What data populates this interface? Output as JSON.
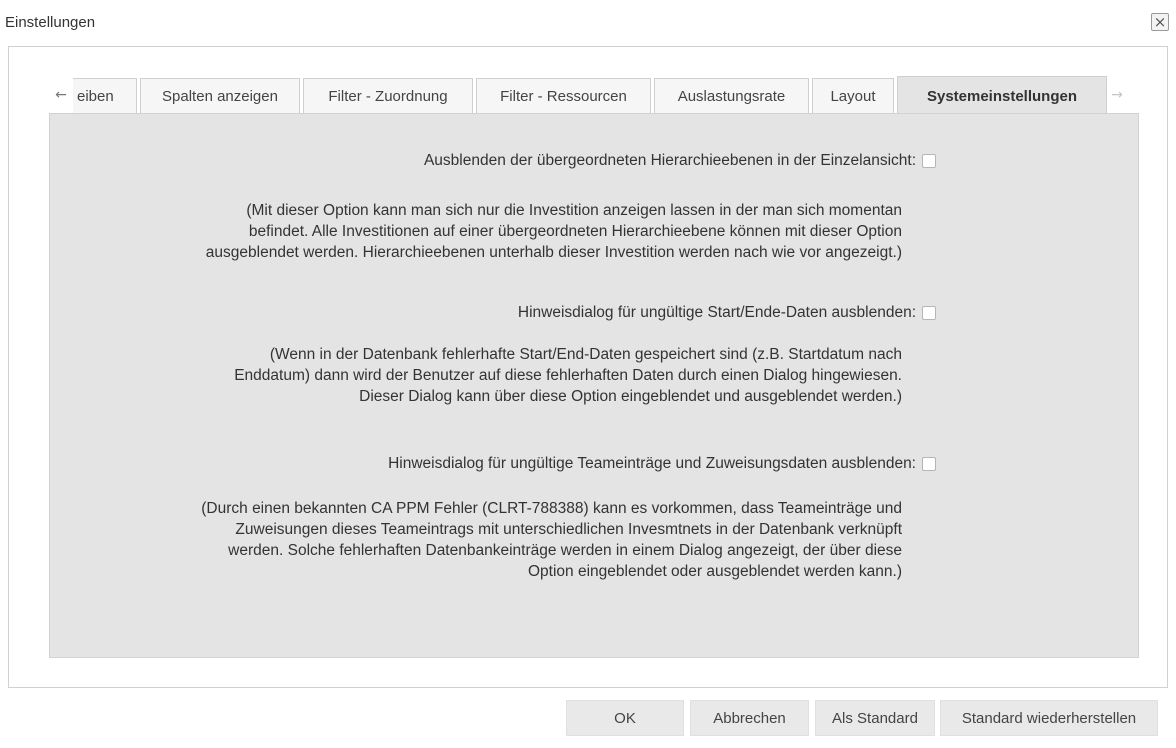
{
  "dialog": {
    "title": "Einstellungen",
    "close_glyph": "×"
  },
  "tabs": {
    "prev_glyph": "←",
    "next_glyph": "→",
    "items": [
      {
        "label": "eiben",
        "active": false
      },
      {
        "label": "Spalten anzeigen",
        "active": false
      },
      {
        "label": "Filter - Zuordnung",
        "active": false
      },
      {
        "label": "Filter - Ressourcen",
        "active": false
      },
      {
        "label": "Auslastungsrate",
        "active": false
      },
      {
        "label": "Layout",
        "active": false
      },
      {
        "label": "Systemeinstellungen",
        "active": true
      }
    ]
  },
  "options": [
    {
      "label": "Ausblenden der übergeordneten Hierarchieebenen in der Einzelansicht:",
      "checked": false,
      "description": [
        "(Mit dieser Option kann man sich nur die Investition anzeigen lassen in der man sich momentan",
        "befindet. Alle Investitionen auf einer übergeordneten Hierarchieebene können mit dieser Option",
        "ausgeblendet werden. Hierarchieebenen unterhalb dieser Investition werden nach wie vor angezeigt.)"
      ]
    },
    {
      "label": "Hinweisdialog für ungültige Start/Ende-Daten ausblenden:",
      "checked": false,
      "description": [
        "(Wenn in der Datenbank fehlerhafte Start/End-Daten gespeichert sind (z.B. Startdatum nach",
        "Enddatum) dann wird der Benutzer auf diese fehlerhaften Daten durch einen Dialog hingewiesen.",
        "Dieser Dialog kann über diese Option eingeblendet und ausgeblendet werden.)"
      ]
    },
    {
      "label": "Hinweisdialog für ungültige Teameinträge und Zuweisungsdaten ausblenden:",
      "checked": false,
      "description": [
        "(Durch einen bekannten CA PPM Fehler (CLRT-788388) kann es vorkommen, dass Teameinträge und",
        "Zuweisungen dieses Teameintrags mit unterschiedlichen Invesmtnets in der Datenbank verknüpft",
        "werden. Solche fehlerhaften Datenbankeinträge werden in einem Dialog angezeigt, der über diese",
        "Option eingeblendet oder ausgeblendet werden kann.)"
      ]
    }
  ],
  "buttons": {
    "ok": "OK",
    "cancel": "Abbrechen",
    "set_default": "Als Standard",
    "restore_default": "Standard wiederherstellen"
  }
}
